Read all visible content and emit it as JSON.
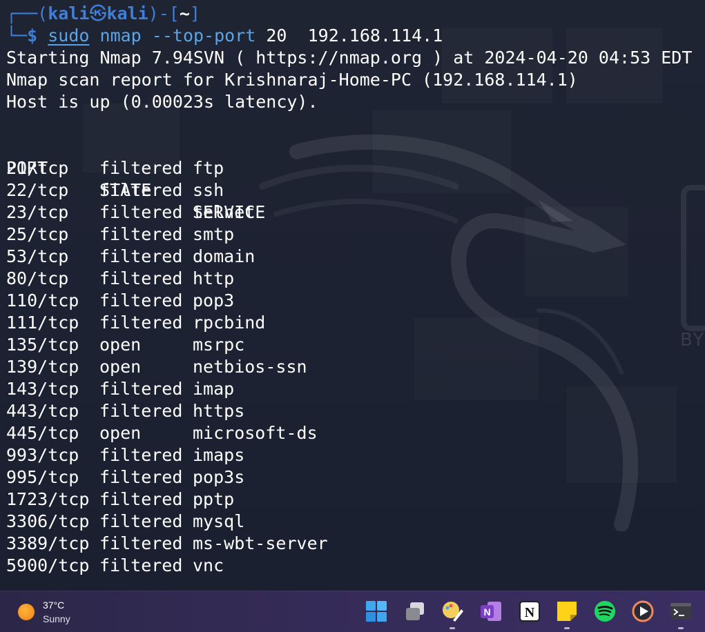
{
  "terminal": {
    "prompt": {
      "frame_top": "┌──(",
      "user": "kali",
      "skull": "㉿",
      "host": "kali",
      "mid": ")-[",
      "dir": "~",
      "end": "]",
      "frame_bottom": "└─",
      "dollar": "$"
    },
    "command": {
      "sudo": "sudo",
      "name": "nmap",
      "flag": "--top-port",
      "count": "20",
      "target": "192.168.114.1"
    },
    "output_lines": [
      "Starting Nmap 7.94SVN ( https://nmap.org ) at 2024-04-20 04:53 EDT",
      "Nmap scan report for Krishnaraj-Home-PC (192.168.114.1)",
      "Host is up (0.00023s latency)."
    ],
    "table_headers": {
      "port": "PORT",
      "state": "STATE",
      "service": "SERVICE"
    },
    "ports": [
      {
        "port": "21/tcp",
        "state": "filtered",
        "service": "ftp"
      },
      {
        "port": "22/tcp",
        "state": "filtered",
        "service": "ssh"
      },
      {
        "port": "23/tcp",
        "state": "filtered",
        "service": "telnet"
      },
      {
        "port": "25/tcp",
        "state": "filtered",
        "service": "smtp"
      },
      {
        "port": "53/tcp",
        "state": "filtered",
        "service": "domain"
      },
      {
        "port": "80/tcp",
        "state": "filtered",
        "service": "http"
      },
      {
        "port": "110/tcp",
        "state": "filtered",
        "service": "pop3"
      },
      {
        "port": "111/tcp",
        "state": "filtered",
        "service": "rpcbind"
      },
      {
        "port": "135/tcp",
        "state": "open",
        "service": "msrpc"
      },
      {
        "port": "139/tcp",
        "state": "open",
        "service": "netbios-ssn"
      },
      {
        "port": "143/tcp",
        "state": "filtered",
        "service": "imap"
      },
      {
        "port": "443/tcp",
        "state": "filtered",
        "service": "https"
      },
      {
        "port": "445/tcp",
        "state": "open",
        "service": "microsoft-ds"
      },
      {
        "port": "993/tcp",
        "state": "filtered",
        "service": "imaps"
      },
      {
        "port": "995/tcp",
        "state": "filtered",
        "service": "pop3s"
      },
      {
        "port": "1723/tcp",
        "state": "filtered",
        "service": "pptp"
      },
      {
        "port": "3306/tcp",
        "state": "filtered",
        "service": "mysql"
      },
      {
        "port": "3389/tcp",
        "state": "filtered",
        "service": "ms-wbt-server"
      },
      {
        "port": "5900/tcp",
        "state": "filtered",
        "service": "vnc"
      }
    ]
  },
  "desktop": {
    "watermark": "BY"
  },
  "taskbar": {
    "weather": {
      "temp": "37°C",
      "desc": "Sunny",
      "icon": "sun-icon"
    },
    "apps": [
      {
        "name": "start-button",
        "icon": "windows-icon"
      },
      {
        "name": "task-view-button",
        "icon": "task-view-icon"
      },
      {
        "name": "paint-app",
        "icon": "paint-icon"
      },
      {
        "name": "onenote-app",
        "icon": "onenote-icon"
      },
      {
        "name": "notion-app",
        "icon": "notion-icon"
      },
      {
        "name": "sticky-notes-app",
        "icon": "sticky-notes-icon"
      },
      {
        "name": "spotify-app",
        "icon": "spotify-icon"
      },
      {
        "name": "media-player-app",
        "icon": "media-player-icon"
      },
      {
        "name": "terminal-app",
        "icon": "terminal-icon"
      }
    ],
    "colors": {
      "windows_blue": "#3fa6f2",
      "onenote_purple": "#7b3fc4",
      "spotify_green": "#1ed760",
      "sticky_yellow": "#ffd21a"
    }
  },
  "colors": {
    "prompt_blue": "#3f7fd9",
    "command_blue": "#5aa5e8",
    "text": "#ffffff",
    "background": "#1d2232",
    "taskbar": "#352b58"
  }
}
